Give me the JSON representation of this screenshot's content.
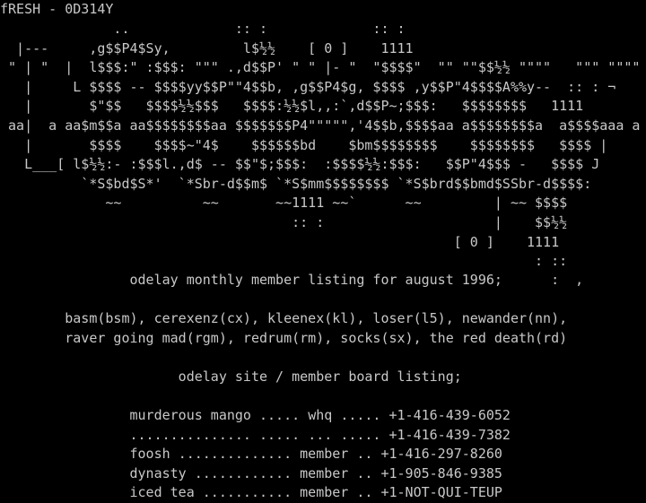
{
  "window": {
    "title": "fRESH - 0D314Y"
  },
  "art_lines": [
    "              ..             :: :             :: :",
    "  |---     ,g$$P4$Sy,         l$½½    [ 0 ]    1111",
    " \" | \"  |  l$$$:\" :$$$: \"\"\" .,d$$P' \" \" |- \"  \"$$$$\"  \"\" \"\"$$½½ \"\"\"\"   \"\"\" \"\"\"\"",
    "   |     L $$$$ -- $$$$yy$$P\"\"4$$b, ,g$$P4$g, $$$$ ,y$$P\"4$$$$A%%y--  :: : ¬",
    "   |       $\"$$   $$$$½½$$$   $$$$:½½$l,,:`,d$$P~;$$$:   $$$$$$$$   1111",
    " aa|  a aa$m$$a aa$$$$$$$$aa $$$$$$$P4\"\"\"\"\",'4$$b,$$$$aa a$$$$$$$$a  a$$$$aaa a",
    "   |       $$$$    $$$$~\"4$    $$$$$$bd    $bm$$$$$$$$    $$$$$$$$   $$$$ |",
    "   L___[ l$½½:- :$$$l.,d$ -- $$\"$;$$$:  :$$$$½½:$$$:   $$P\"4$$$ -   $$$$ J",
    "          `*S$bd$S*'  `*Sbr-d$$m$ `*S$mm$$$$$$$$ `*S$brd$$bmd$SSbr-d$$$$:",
    "             ~~          ~~       ~~1111 ~~`      ~~         | ~~ $$$$",
    "                                    :: :                     |    $$½½",
    "                                                        [ 0 ]    1111",
    "                                                                  : ::"
  ],
  "tagline": {
    "text": "                odelay monthly member listing for august 1996;      :  ,"
  },
  "members": {
    "line1": "        basm(bsm), cerexenz(cx), kleenex(kl), loser(l5), newander(nn),",
    "line2": "        raver going mad(rgm), redrum(rm), socks(sx), the red death(rd)"
  },
  "site_heading": {
    "text": "                      odelay site / member board listing;"
  },
  "site_rows": [
    {
      "name": "murderous mango",
      "dots": ".....",
      "role": "whq",
      "dots2": ".....",
      "phone": "+1-416-439-6052"
    },
    {
      "name": "...............",
      "dots": ".....",
      "role": "...",
      "dots2": ".....",
      "phone": "+1-416-439-7382"
    },
    {
      "name": "foosh",
      "dots": "..............",
      "role": "member",
      "dots2": "..",
      "phone": "+1-416-297-8260"
    },
    {
      "name": "dynasty",
      "dots": "............",
      "role": "member",
      "dots2": "..",
      "phone": "+1-905-846-9385"
    },
    {
      "name": "iced tea",
      "dots": "...........",
      "role": "member",
      "dots2": "..",
      "phone": "+1-NOT-QUI-TEUP"
    }
  ],
  "colors": {
    "background": "#000000",
    "text": "#c8c8c8"
  }
}
